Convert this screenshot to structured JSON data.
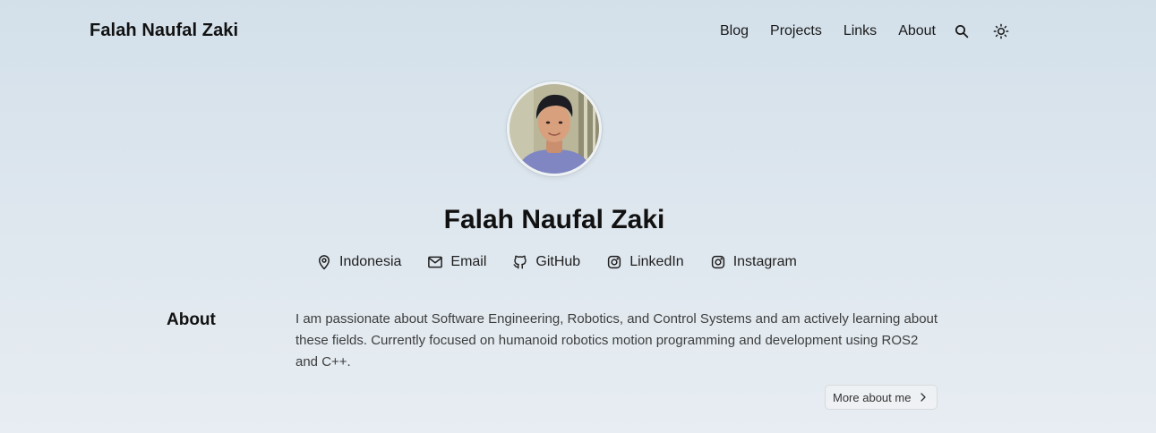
{
  "header": {
    "site_title": "Falah Naufal Zaki",
    "nav": [
      {
        "label": "Blog"
      },
      {
        "label": "Projects"
      },
      {
        "label": "Links"
      },
      {
        "label": "About"
      }
    ],
    "search_icon": "search-icon",
    "theme_icon": "sun-icon"
  },
  "profile": {
    "name": "Falah Naufal Zaki",
    "avatar": "profile-photo",
    "links": [
      {
        "label": "Indonesia",
        "icon": "map-pin-icon"
      },
      {
        "label": "Email",
        "icon": "mail-icon"
      },
      {
        "label": "GitHub",
        "icon": "github-icon"
      },
      {
        "label": "LinkedIn",
        "icon": "linkedin-icon"
      },
      {
        "label": "Instagram",
        "icon": "instagram-icon"
      }
    ]
  },
  "about": {
    "heading": "About",
    "text": "I am passionate about Software Engineering, Robotics, and Control Systems and am actively learning about these fields. Currently focused on humanoid robotics motion programming and development using ROS2 and C++.",
    "button_label": "More about me"
  },
  "colors": {
    "background_top": "#d3e0ea",
    "background_bottom": "#e7edf2",
    "text": "#111111",
    "muted_text": "#3d3d3d"
  }
}
